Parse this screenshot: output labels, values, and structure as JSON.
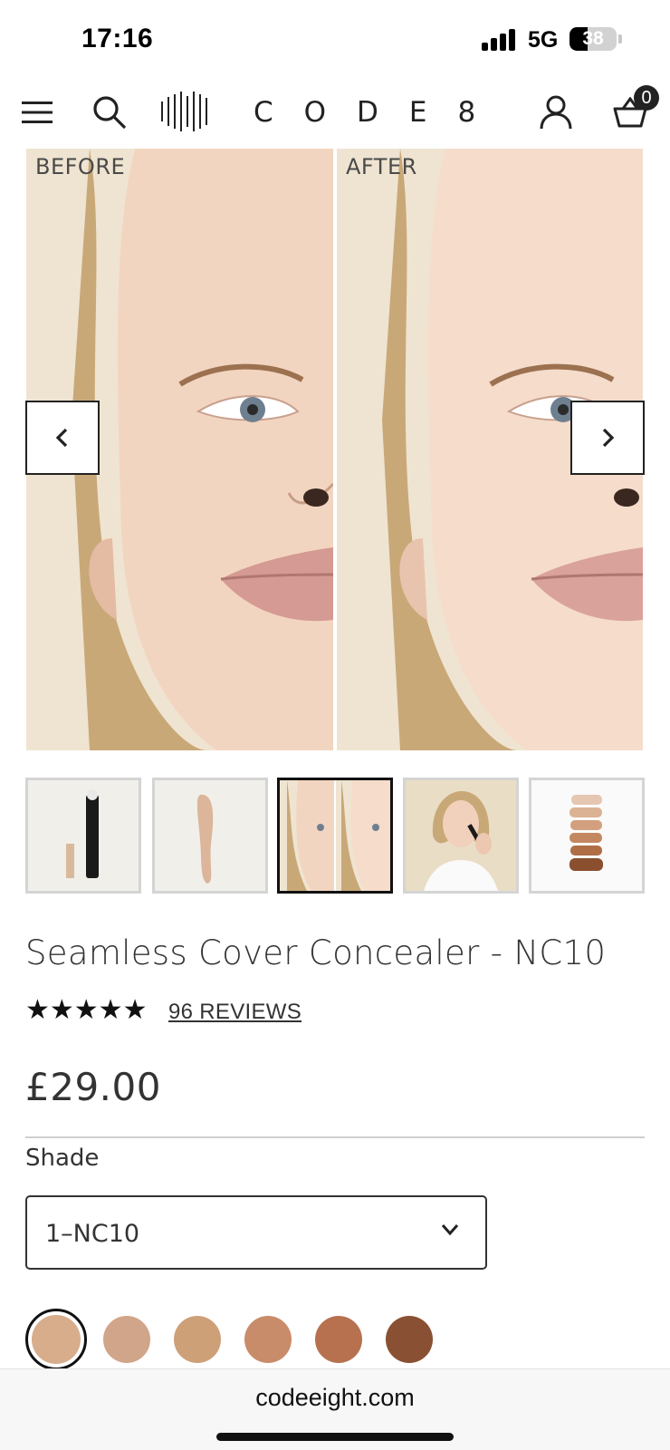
{
  "status_bar": {
    "time": "17:16",
    "network": "5G",
    "battery_level": 38,
    "battery_text": "38"
  },
  "header": {
    "logo_text": "CODE8",
    "cart_count": "0",
    "icons": [
      "menu-icon",
      "search-icon",
      "logo-mark",
      "account-icon",
      "basket-icon"
    ]
  },
  "gallery": {
    "before_label": "BEFORE",
    "after_label": "AFTER",
    "active_thumbnail": 3,
    "thumbnails": [
      "concealer-pen",
      "concealer-swatch",
      "before-after",
      "model-applying",
      "shade-range"
    ]
  },
  "product": {
    "title": "Seamless Cover Concealer - NC10",
    "rating": 5,
    "stars": "★★★★★",
    "reviews_label": "96 REVIEWS",
    "price": "£29.00"
  },
  "shade": {
    "label": "Shade",
    "selected_value": "1–NC10",
    "swatch_colors": [
      "#d7ad8c",
      "#d1a589",
      "#cea078",
      "#c98c6a",
      "#b7714f",
      "#8a5033"
    ]
  },
  "browser": {
    "url": "codeeight.com"
  },
  "colors": {
    "text": "#333333",
    "accent": "#111111",
    "skin_bg": "#efe5d4"
  }
}
